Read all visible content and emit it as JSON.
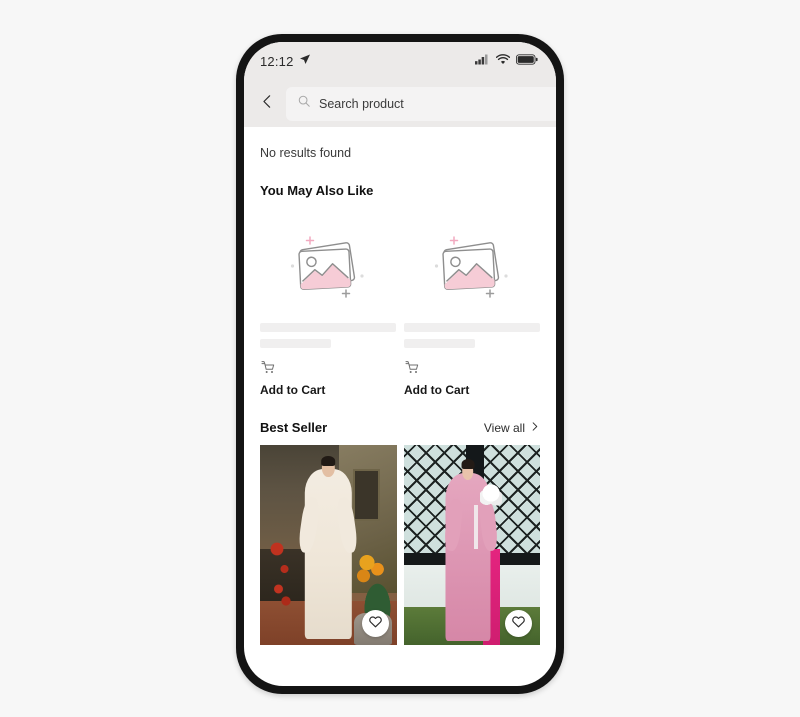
{
  "status_bar": {
    "time": "12:12",
    "location_icon": "location-arrow-icon",
    "signal_icon": "cellular-signal-icon",
    "wifi_icon": "wifi-icon",
    "battery_icon": "battery-full-icon"
  },
  "header": {
    "back_icon": "chevron-left-icon",
    "search_icon": "search-icon",
    "search_value": "",
    "search_placeholder": "Search product"
  },
  "results": {
    "empty_message": "No results found"
  },
  "suggestions": {
    "title": "You May Also Like",
    "cards": [
      {
        "placeholder_icon": "image-placeholder-icon",
        "cart_icon": "shopping-cart-icon",
        "add_to_cart_label": "Add to Cart"
      },
      {
        "placeholder_icon": "image-placeholder-icon",
        "cart_icon": "shopping-cart-icon",
        "add_to_cart_label": "Add to Cart"
      }
    ]
  },
  "best_seller": {
    "title": "Best Seller",
    "view_all_label": "View all",
    "view_all_icon": "chevron-right-icon",
    "products": [
      {
        "favorite_icon": "heart-outline-icon"
      },
      {
        "favorite_icon": "heart-outline-icon"
      }
    ]
  },
  "colors": {
    "page_background": "#f7f7f7",
    "device_frame": "#141414",
    "status_bar": "#eceae9",
    "search_field": "#f4f3f3",
    "skeleton": "#f0efef",
    "placeholder_pink": "#f6ccd6",
    "placeholder_gray": "#8a8a8a",
    "text_primary": "#111111"
  }
}
